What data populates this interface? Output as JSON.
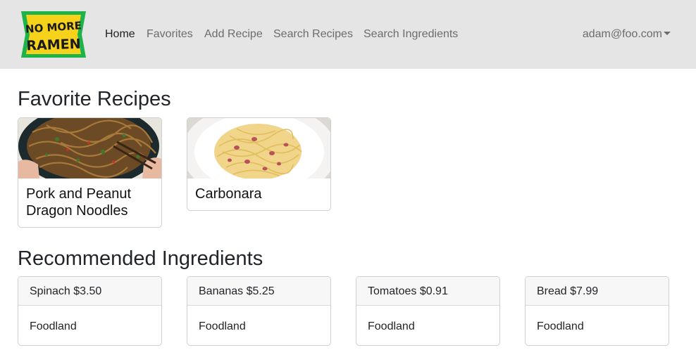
{
  "brand": {
    "logo_text": "NO MORE RAMEN",
    "logo_line1": "NO MORE",
    "logo_line2": "RAMEN",
    "logo_bg": "#1db34a",
    "logo_fg": "#f7d21b"
  },
  "nav": {
    "links": [
      "Home",
      "Favorites",
      "Add Recipe",
      "Search Recipes",
      "Search Ingredients"
    ],
    "active": "Home",
    "user": "adam@foo.com"
  },
  "favorites": {
    "title": "Favorite Recipes",
    "recipes": [
      {
        "name": "Pork and Peanut Dragon Noodles",
        "image": "noodles-photo"
      },
      {
        "name": "Carbonara",
        "image": "carbonara-photo"
      }
    ]
  },
  "recommended": {
    "title": "Recommended Ingredients",
    "ingredients": [
      {
        "header": "Spinach $3.50",
        "store": "Foodland"
      },
      {
        "header": "Bananas $5.25",
        "store": "Foodland"
      },
      {
        "header": "Tomatoes $0.91",
        "store": "Foodland"
      },
      {
        "header": "Bread $7.99",
        "store": "Foodland"
      }
    ]
  },
  "colors": {
    "navbar_bg": "#e5e5e5",
    "nav_link": "#6c6c6c",
    "nav_active": "#1f1f1f"
  }
}
